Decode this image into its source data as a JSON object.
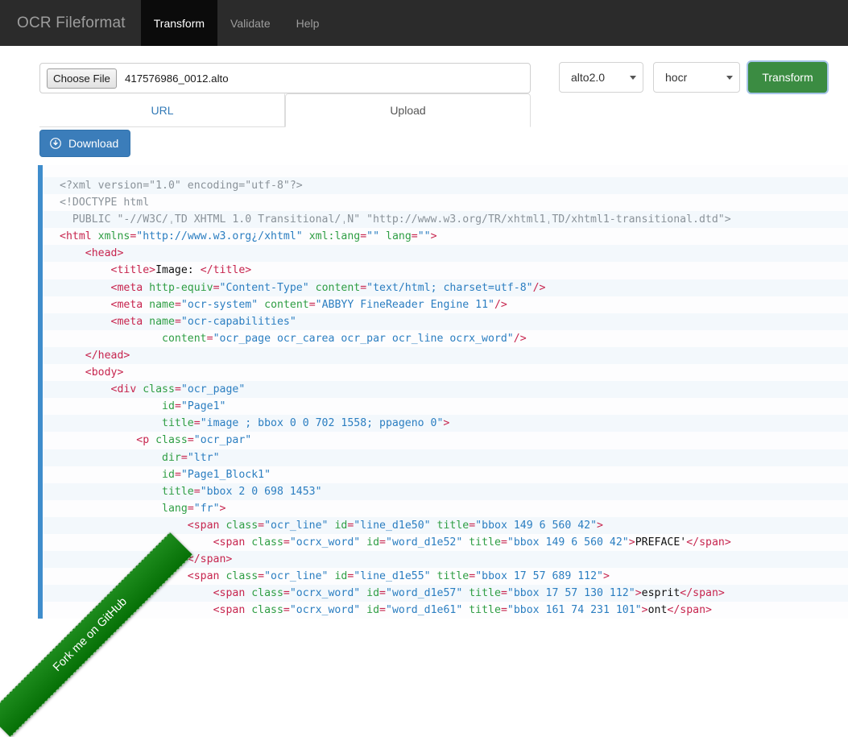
{
  "navbar": {
    "brand": "OCR Fileformat",
    "items": [
      {
        "label": "Transform",
        "active": true
      },
      {
        "label": "Validate",
        "active": false
      },
      {
        "label": "Help",
        "active": false
      }
    ]
  },
  "form": {
    "choose_file_label": "Choose File",
    "file_name": "417576986_0012.alto",
    "tabs": [
      {
        "label": "URL",
        "active": false
      },
      {
        "label": "Upload",
        "active": true
      }
    ],
    "input_format": "alto2.0",
    "output_format": "hocr",
    "transform_label": "Transform",
    "download_label": "Download"
  },
  "ribbon": {
    "label": "Fork me on GitHub"
  },
  "colors": {
    "navbar_bg": "#2b2b2b",
    "navbar_active_bg": "#0b0b0b",
    "accent_blue": "#3b7dba",
    "code_border": "#3f8dcc",
    "transform_green": "#3b8c42",
    "ribbon_green": "#1d8b1d",
    "code_tag": "#c7254e",
    "code_attr": "#2f9e44",
    "code_value": "#2b7ec1"
  },
  "code": {
    "lines": [
      {
        "indent": 0,
        "parts": [
          {
            "c": "g",
            "s": "<?xml version=\"1.0\" encoding=\"utf-8\"?>"
          }
        ]
      },
      {
        "indent": 0,
        "parts": [
          {
            "c": "g",
            "s": "<!DOCTYPE html"
          }
        ]
      },
      {
        "indent": 0,
        "parts": [
          {
            "c": "g",
            "s": "  PUBLIC \"-//W3C/ˌTD XHTML 1.0 Transitional/ˌN\" \"http://www.w3.org/TR/xhtml1ˌTD/xhtml1-transitional.dtd\">"
          }
        ]
      },
      {
        "indent": 0,
        "parts": [
          {
            "c": "t",
            "s": "<html "
          },
          {
            "c": "a",
            "s": "xmlns"
          },
          {
            "c": "t",
            "s": "="
          },
          {
            "c": "v",
            "s": "\"http://www.w3.org¿/xhtml\""
          },
          {
            "c": "t",
            "s": " "
          },
          {
            "c": "a",
            "s": "xml:lang"
          },
          {
            "c": "t",
            "s": "="
          },
          {
            "c": "v",
            "s": "\"\""
          },
          {
            "c": "t",
            "s": " "
          },
          {
            "c": "a",
            "s": "lang"
          },
          {
            "c": "t",
            "s": "="
          },
          {
            "c": "v",
            "s": "\"\""
          },
          {
            "c": "t",
            "s": ">"
          }
        ]
      },
      {
        "indent": 1,
        "parts": [
          {
            "c": "t",
            "s": "<head>"
          }
        ]
      },
      {
        "indent": 2,
        "parts": [
          {
            "c": "t",
            "s": "<title>"
          },
          {
            "c": "txt",
            "s": "Image: "
          },
          {
            "c": "t",
            "s": "</title>"
          }
        ]
      },
      {
        "indent": 2,
        "parts": [
          {
            "c": "t",
            "s": "<meta "
          },
          {
            "c": "a",
            "s": "http-equiv"
          },
          {
            "c": "t",
            "s": "="
          },
          {
            "c": "v",
            "s": "\"Content-Type\""
          },
          {
            "c": "t",
            "s": " "
          },
          {
            "c": "a",
            "s": "content"
          },
          {
            "c": "t",
            "s": "="
          },
          {
            "c": "v",
            "s": "\"text/html; charset=utf-8\""
          },
          {
            "c": "t",
            "s": "/>"
          }
        ]
      },
      {
        "indent": 2,
        "parts": [
          {
            "c": "t",
            "s": "<meta "
          },
          {
            "c": "a",
            "s": "name"
          },
          {
            "c": "t",
            "s": "="
          },
          {
            "c": "v",
            "s": "\"ocr-system\""
          },
          {
            "c": "t",
            "s": " "
          },
          {
            "c": "a",
            "s": "content"
          },
          {
            "c": "t",
            "s": "="
          },
          {
            "c": "v",
            "s": "\"ABBYY FineReader Engine 11\""
          },
          {
            "c": "t",
            "s": "/>"
          }
        ]
      },
      {
        "indent": 2,
        "parts": [
          {
            "c": "t",
            "s": "<meta "
          },
          {
            "c": "a",
            "s": "name"
          },
          {
            "c": "t",
            "s": "="
          },
          {
            "c": "v",
            "s": "\"ocr-capabilities\""
          }
        ]
      },
      {
        "indent": 4,
        "parts": [
          {
            "c": "a",
            "s": "content"
          },
          {
            "c": "t",
            "s": "="
          },
          {
            "c": "v",
            "s": "\"ocr_page ocr_carea ocr_par ocr_line ocrx_word\""
          },
          {
            "c": "t",
            "s": "/>"
          }
        ]
      },
      {
        "indent": 1,
        "parts": [
          {
            "c": "t",
            "s": "</head>"
          }
        ]
      },
      {
        "indent": 1,
        "parts": [
          {
            "c": "t",
            "s": "<body>"
          }
        ]
      },
      {
        "indent": 2,
        "parts": [
          {
            "c": "t",
            "s": "<div "
          },
          {
            "c": "a",
            "s": "class"
          },
          {
            "c": "t",
            "s": "="
          },
          {
            "c": "v",
            "s": "\"ocr_page\""
          }
        ]
      },
      {
        "indent": 4,
        "parts": [
          {
            "c": "a",
            "s": "id"
          },
          {
            "c": "t",
            "s": "="
          },
          {
            "c": "v",
            "s": "\"Page1\""
          }
        ]
      },
      {
        "indent": 4,
        "parts": [
          {
            "c": "a",
            "s": "title"
          },
          {
            "c": "t",
            "s": "="
          },
          {
            "c": "v",
            "s": "\"image ; bbox 0 0 702 1558; ppageno 0\""
          },
          {
            "c": "t",
            "s": ">"
          }
        ]
      },
      {
        "indent": 3,
        "parts": [
          {
            "c": "t",
            "s": "<p "
          },
          {
            "c": "a",
            "s": "class"
          },
          {
            "c": "t",
            "s": "="
          },
          {
            "c": "v",
            "s": "\"ocr_par\""
          }
        ]
      },
      {
        "indent": 4,
        "parts": [
          {
            "c": "a",
            "s": "dir"
          },
          {
            "c": "t",
            "s": "="
          },
          {
            "c": "v",
            "s": "\"ltr\""
          }
        ]
      },
      {
        "indent": 4,
        "parts": [
          {
            "c": "a",
            "s": "id"
          },
          {
            "c": "t",
            "s": "="
          },
          {
            "c": "v",
            "s": "\"Page1_Block1\""
          }
        ]
      },
      {
        "indent": 4,
        "parts": [
          {
            "c": "a",
            "s": "title"
          },
          {
            "c": "t",
            "s": "="
          },
          {
            "c": "v",
            "s": "\"bbox 2 0 698 1453\""
          }
        ]
      },
      {
        "indent": 4,
        "parts": [
          {
            "c": "a",
            "s": "lang"
          },
          {
            "c": "t",
            "s": "="
          },
          {
            "c": "v",
            "s": "\"fr\""
          },
          {
            "c": "t",
            "s": ">"
          }
        ]
      },
      {
        "indent": 5,
        "parts": [
          {
            "c": "t",
            "s": "<span "
          },
          {
            "c": "a",
            "s": "class"
          },
          {
            "c": "t",
            "s": "="
          },
          {
            "c": "v",
            "s": "\"ocr_line\""
          },
          {
            "c": "t",
            "s": " "
          },
          {
            "c": "a",
            "s": "id"
          },
          {
            "c": "t",
            "s": "="
          },
          {
            "c": "v",
            "s": "\"line_d1e50\""
          },
          {
            "c": "t",
            "s": " "
          },
          {
            "c": "a",
            "s": "title"
          },
          {
            "c": "t",
            "s": "="
          },
          {
            "c": "v",
            "s": "\"bbox 149 6 560 42\""
          },
          {
            "c": "t",
            "s": ">"
          }
        ]
      },
      {
        "indent": 6,
        "parts": [
          {
            "c": "t",
            "s": "<span "
          },
          {
            "c": "a",
            "s": "class"
          },
          {
            "c": "t",
            "s": "="
          },
          {
            "c": "v",
            "s": "\"ocrx_word\""
          },
          {
            "c": "t",
            "s": " "
          },
          {
            "c": "a",
            "s": "id"
          },
          {
            "c": "t",
            "s": "="
          },
          {
            "c": "v",
            "s": "\"word_d1e52\""
          },
          {
            "c": "t",
            "s": " "
          },
          {
            "c": "a",
            "s": "title"
          },
          {
            "c": "t",
            "s": "="
          },
          {
            "c": "v",
            "s": "\"bbox 149 6 560 42\""
          },
          {
            "c": "t",
            "s": ">"
          },
          {
            "c": "txt",
            "s": "PREFACE'"
          },
          {
            "c": "t",
            "s": "</span>"
          }
        ]
      },
      {
        "indent": 5,
        "parts": [
          {
            "c": "t",
            "s": "</span>"
          }
        ]
      },
      {
        "indent": 5,
        "parts": [
          {
            "c": "t",
            "s": "<span "
          },
          {
            "c": "a",
            "s": "class"
          },
          {
            "c": "t",
            "s": "="
          },
          {
            "c": "v",
            "s": "\"ocr_line\""
          },
          {
            "c": "t",
            "s": " "
          },
          {
            "c": "a",
            "s": "id"
          },
          {
            "c": "t",
            "s": "="
          },
          {
            "c": "v",
            "s": "\"line_d1e55\""
          },
          {
            "c": "t",
            "s": " "
          },
          {
            "c": "a",
            "s": "title"
          },
          {
            "c": "t",
            "s": "="
          },
          {
            "c": "v",
            "s": "\"bbox 17 57 689 112\""
          },
          {
            "c": "t",
            "s": ">"
          }
        ]
      },
      {
        "indent": 6,
        "parts": [
          {
            "c": "t",
            "s": "<span "
          },
          {
            "c": "a",
            "s": "class"
          },
          {
            "c": "t",
            "s": "="
          },
          {
            "c": "v",
            "s": "\"ocrx_word\""
          },
          {
            "c": "t",
            "s": " "
          },
          {
            "c": "a",
            "s": "id"
          },
          {
            "c": "t",
            "s": "="
          },
          {
            "c": "v",
            "s": "\"word_d1e57\""
          },
          {
            "c": "t",
            "s": " "
          },
          {
            "c": "a",
            "s": "title"
          },
          {
            "c": "t",
            "s": "="
          },
          {
            "c": "v",
            "s": "\"bbox 17 57 130 112\""
          },
          {
            "c": "t",
            "s": ">"
          },
          {
            "c": "txt",
            "s": "esprit"
          },
          {
            "c": "t",
            "s": "</span>"
          }
        ]
      },
      {
        "indent": 6,
        "parts": [
          {
            "c": "t",
            "s": "<span "
          },
          {
            "c": "a",
            "s": "class"
          },
          {
            "c": "t",
            "s": "="
          },
          {
            "c": "v",
            "s": "\"ocrx_word\""
          },
          {
            "c": "t",
            "s": " "
          },
          {
            "c": "a",
            "s": "id"
          },
          {
            "c": "t",
            "s": "="
          },
          {
            "c": "v",
            "s": "\"word_d1e61\""
          },
          {
            "c": "t",
            "s": " "
          },
          {
            "c": "a",
            "s": "title"
          },
          {
            "c": "t",
            "s": "="
          },
          {
            "c": "v",
            "s": "\"bbox 161 74 231 101\""
          },
          {
            "c": "t",
            "s": ">"
          },
          {
            "c": "txt",
            "s": "ont"
          },
          {
            "c": "t",
            "s": "</span>"
          }
        ]
      }
    ]
  }
}
